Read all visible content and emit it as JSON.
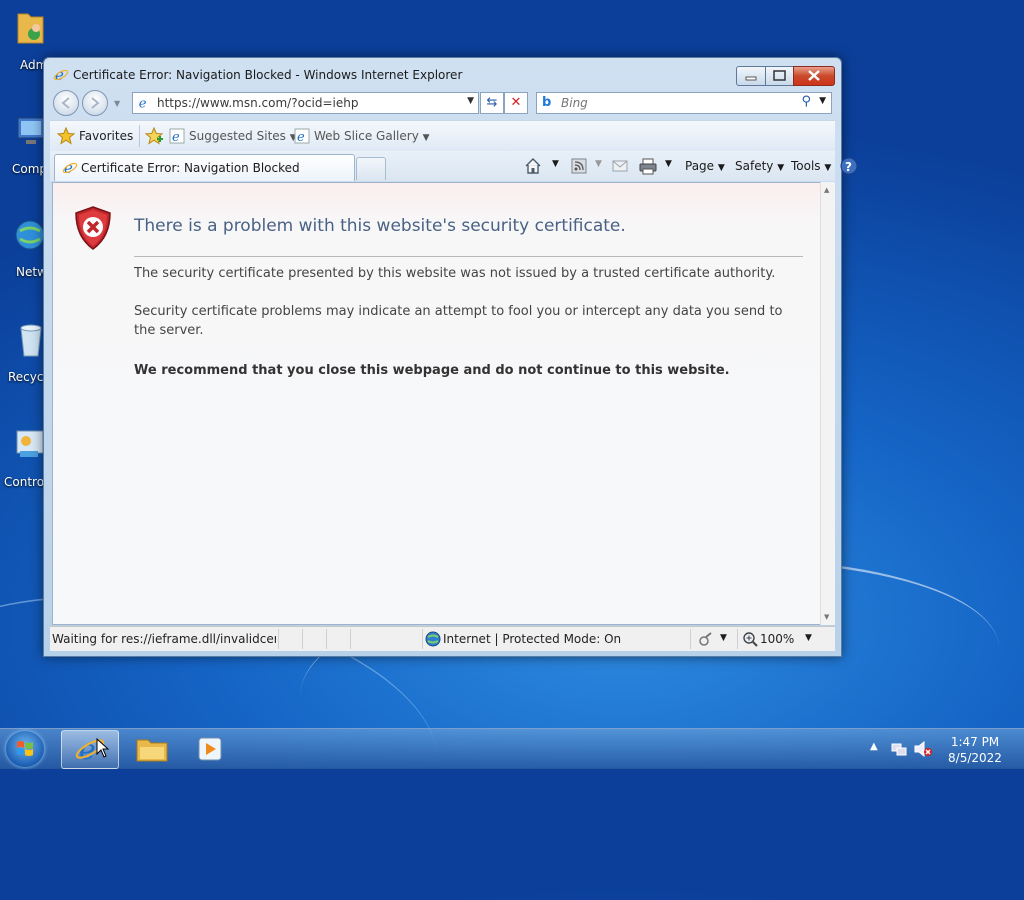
{
  "desktop": {
    "icons": [
      {
        "label": "Adm",
        "icon": "user-folder-icon"
      },
      {
        "label": "Comp",
        "icon": "computer-icon"
      },
      {
        "label": "Netw",
        "icon": "network-icon"
      },
      {
        "label": "Recycl",
        "icon": "recycle-bin-icon"
      },
      {
        "label": "Control",
        "icon": "control-panel-icon"
      }
    ]
  },
  "window": {
    "title": "Certificate Error: Navigation Blocked - Windows Internet Explorer"
  },
  "nav": {
    "url": "https://www.msn.com/?ocid=iehp",
    "search_placeholder": "Bing"
  },
  "favorites_bar": {
    "favorites_label": "Favorites",
    "suggested_sites": "Suggested Sites",
    "web_slice_gallery": "Web Slice Gallery"
  },
  "tabs": [
    {
      "label": "Certificate Error: Navigation Blocked"
    }
  ],
  "command_bar": {
    "page": "Page",
    "safety": "Safety",
    "tools": "Tools"
  },
  "content": {
    "heading": "There is a problem with this website's security certificate.",
    "para1": "The security certificate presented by this website was not issued by a trusted certificate authority.",
    "para2": "Security certificate problems may indicate an attempt to fool you or intercept any data you send to the server.",
    "para3": "We recommend that you close this webpage and do not continue to this website."
  },
  "status_bar": {
    "text": "Waiting for res://ieframe.dll/invalidcert.htm",
    "zone": "Internet | Protected Mode: On",
    "zoom": "100%"
  },
  "taskbar": {
    "time": "1:47 PM",
    "date": "8/5/2022"
  },
  "colors": {
    "heading": "#4a6184",
    "shield_red": "#c0272d",
    "close_button": "#c84a2b"
  }
}
